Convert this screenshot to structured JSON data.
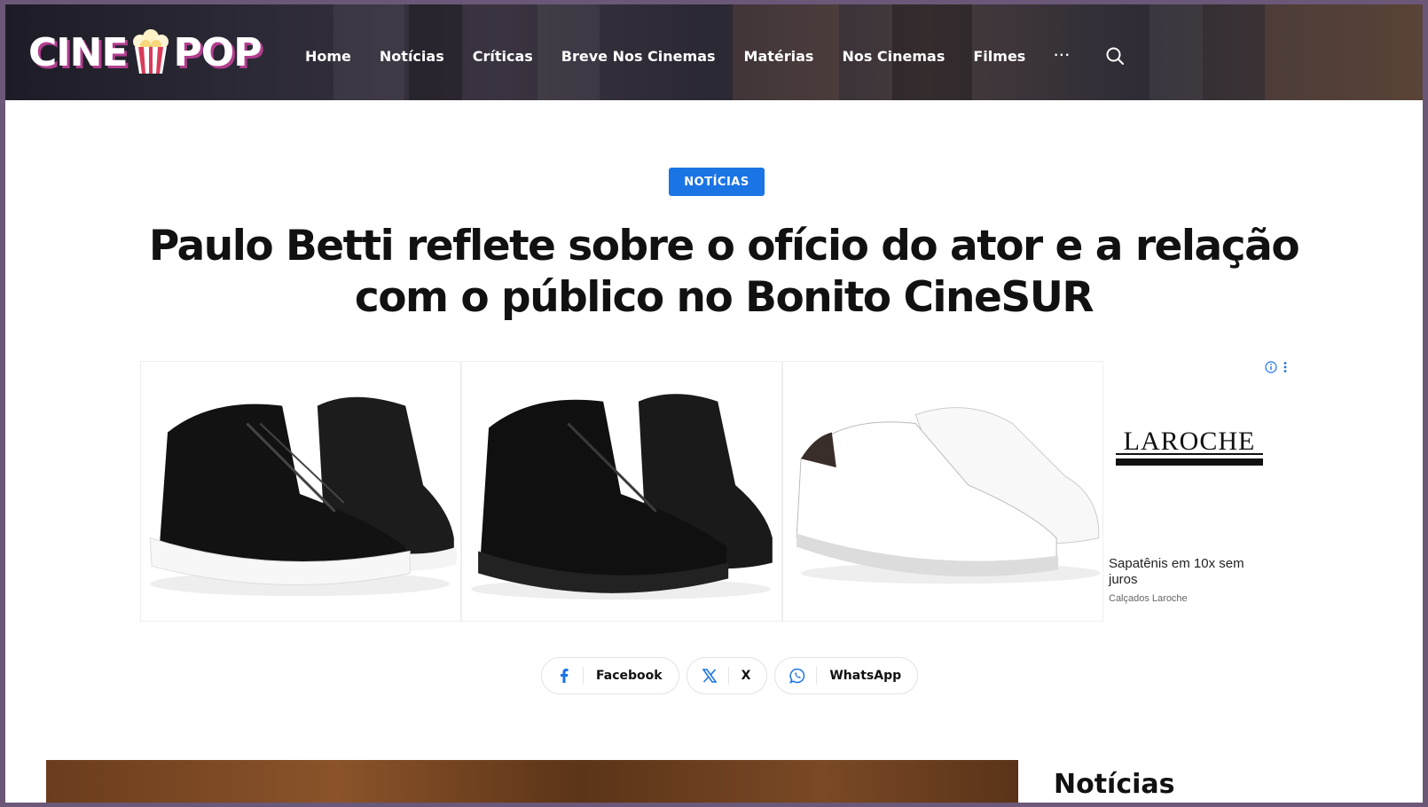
{
  "header": {
    "logo_left": "CINE",
    "logo_right": "POP",
    "nav": [
      "Home",
      "Notícias",
      "Críticas",
      "Breve Nos Cinemas",
      "Matérias",
      "Nos Cinemas",
      "Filmes"
    ],
    "more_label": "···"
  },
  "article": {
    "category": "NOTÍCIAS",
    "title": "Paulo Betti reflete sobre o ofício do ator e a relação com o público no Bonito CineSUR"
  },
  "ad": {
    "brand": "LAROCHE",
    "headline": "Sapatênis em 10x sem juros",
    "source": "Calçados Laroche",
    "products": [
      "black-high-top-white-sole",
      "black-high-top-black-sole",
      "white-low-sneaker"
    ]
  },
  "share": {
    "facebook": "Facebook",
    "x": "X",
    "whatsapp": "WhatsApp"
  },
  "sidebar": {
    "title": "Notícias"
  },
  "colors": {
    "accent": "#1b74e4",
    "logo_shadow": "#b33e8f"
  }
}
